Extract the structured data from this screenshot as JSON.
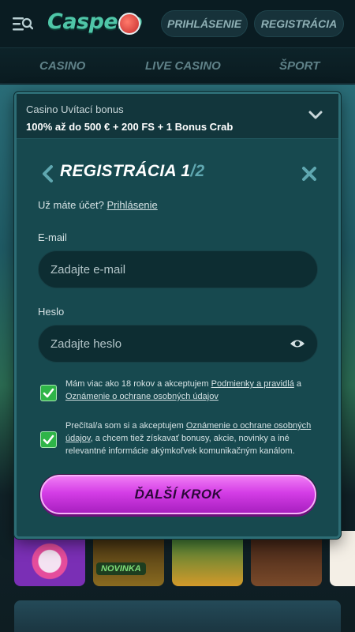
{
  "header": {
    "logo_text": "Caspero",
    "login_label": "PRIHLÁSENIE",
    "register_label": "REGISTRÁCIA"
  },
  "nav": {
    "items": [
      "CASINO",
      "LIVE CASINO",
      "ŠPORT"
    ]
  },
  "background": {
    "badge_novinka": "NOVINKA"
  },
  "modal": {
    "bonus_title": "Casino Uvítací bonus",
    "bonus_text": "100% až do 500 € + 200 FS + 1 Bonus Crab",
    "title": "REGISTRÁCIA",
    "step_current": "1",
    "step_total": "/2",
    "account_question": "Už máte účet?",
    "account_link": "Prihlásenie",
    "email": {
      "label": "E-mail",
      "placeholder": "Zadajte e-mail"
    },
    "password": {
      "label": "Heslo",
      "placeholder": "Zadajte heslo"
    },
    "checkbox_1": {
      "checked": true,
      "text_a": "Mám viac ako 18 rokov a akceptujem ",
      "link_a": "Podmienky a pravidlá",
      "text_b": " a ",
      "link_b": "Oznámenie o ochrane osobných údajov"
    },
    "checkbox_2": {
      "checked": true,
      "text_a": "Prečítal/a som si a akceptujem ",
      "link_a": "Oznámenie o ochrane osobných údajov",
      "text_b": ", a chcem tiež získavať bonusy, akcie, novinky a iné relevantné informácie akýmkoľvek komunikačným kanálom."
    },
    "next_label": "ĎALŠÍ KROK"
  },
  "colors": {
    "accent_magenta": "#d43de6",
    "check_green": "#2fb548",
    "modal_bg": "#17494f"
  }
}
